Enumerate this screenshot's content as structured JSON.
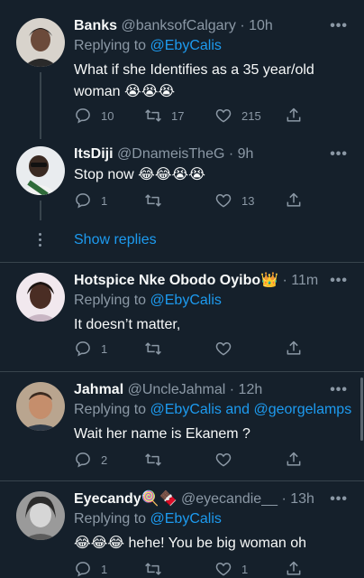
{
  "tweets": [
    {
      "name": "Banks",
      "handle": "@banksofCalgary",
      "sep": " · ",
      "time": "10h",
      "replying_prefix": "Replying to ",
      "replying_to": "@EbyCalis",
      "text": "What if she Identifies as a 35 year/old woman 😭😭😭",
      "replies": "10",
      "retweets": "17",
      "likes": "215"
    },
    {
      "name": "ItsDiji",
      "handle": "@DnameisTheG",
      "sep": " · ",
      "time": "9h",
      "text": "Stop now 😂😂😭😭",
      "replies": "1",
      "retweets": "",
      "likes": "13"
    },
    {
      "name": "Hotspice Nke Obodo Oyibo👑",
      "handle": "",
      "sep": " · ",
      "time": "11m",
      "replying_prefix": "Replying to ",
      "replying_to": "@EbyCalis",
      "text": "It doesn’t matter,",
      "replies": "1",
      "retweets": "",
      "likes": ""
    },
    {
      "name": "Jahmal",
      "handle": "@UncleJahmal",
      "sep": " · ",
      "time": "12h",
      "replying_prefix": "Replying to ",
      "replying_to": "@EbyCalis and @georgelamps",
      "text": "Wait her name is Ekanem ?",
      "replies": "2",
      "retweets": "",
      "likes": ""
    },
    {
      "name": "Eyecandy🍭🍫",
      "handle": "@eyecandie__",
      "sep": " · ",
      "time": "13h",
      "replying_prefix": "Replying to ",
      "replying_to": "@EbyCalis",
      "text": "😂😂😂 hehe! You be big woman oh",
      "replies": "1",
      "retweets": "",
      "likes": "1"
    }
  ],
  "show_replies": "Show replies",
  "more_glyph": "•••",
  "colors": {
    "background": "#15202b",
    "divider": "#38444d",
    "secondary_text": "#8b98a5",
    "link": "#1d9bf0"
  }
}
